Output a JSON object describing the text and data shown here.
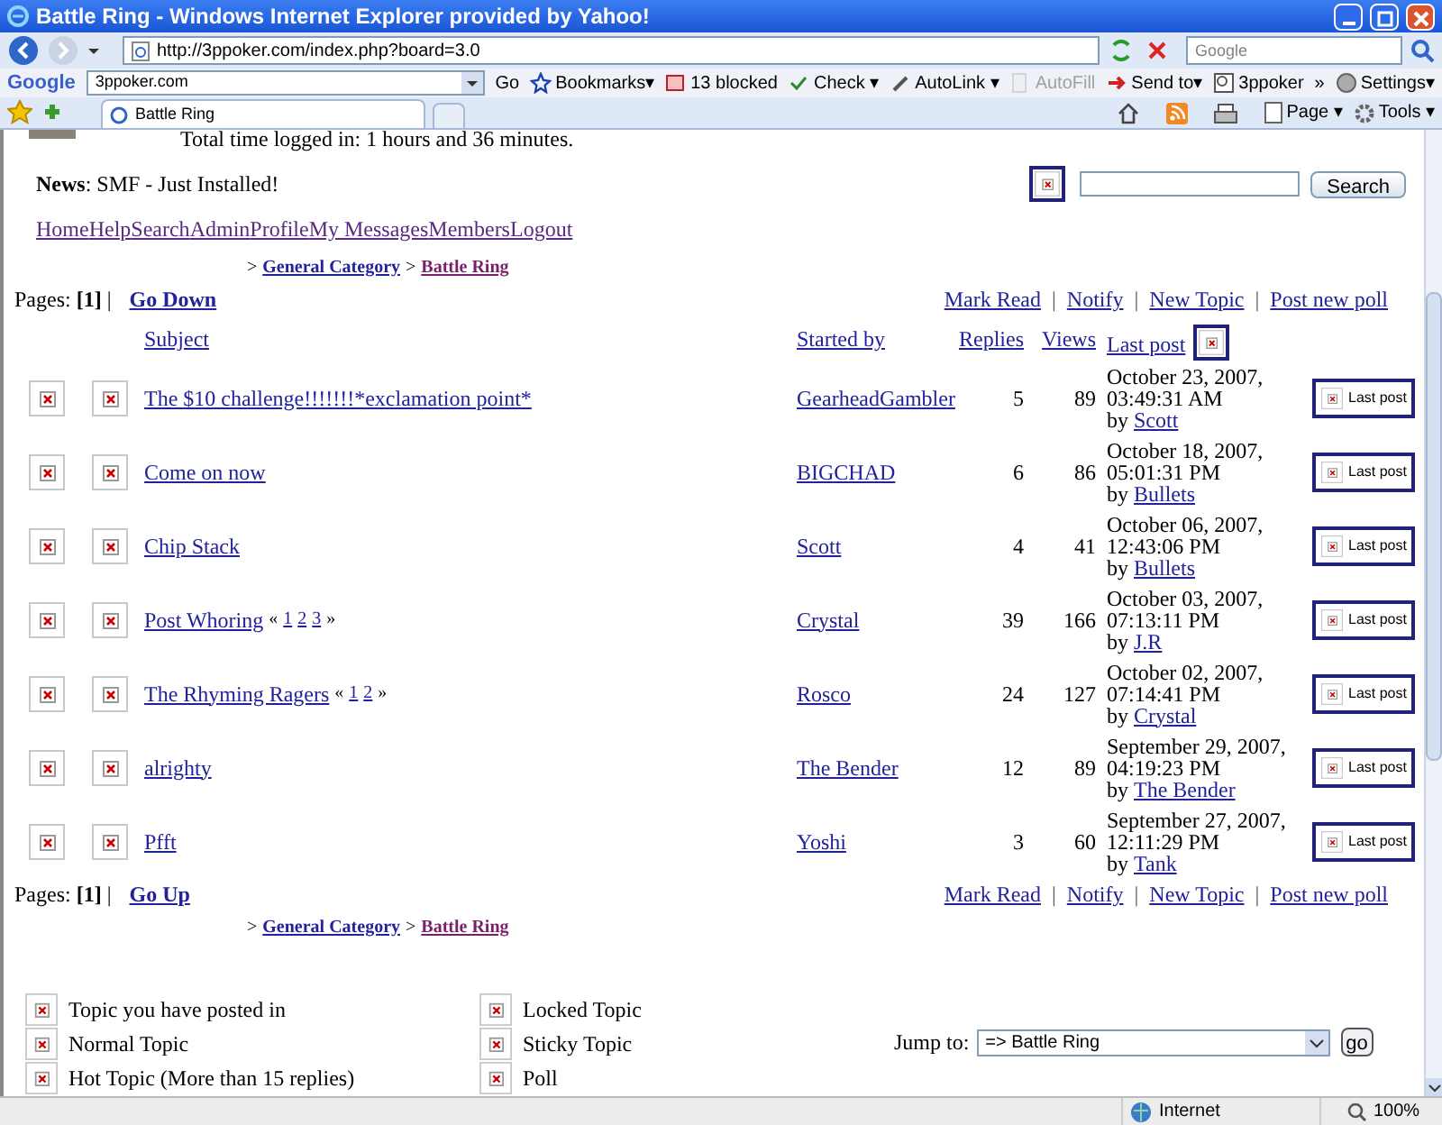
{
  "window": {
    "title": "Battle Ring - Windows Internet Explorer provided by Yahoo!"
  },
  "address_bar": {
    "url": "http://3ppoker.com/index.php?board=3.0",
    "search_placeholder": "Google"
  },
  "google_toolbar": {
    "label": "Google",
    "search_value": "3ppoker.com",
    "items": [
      {
        "label": "Go",
        "disabled": false
      },
      {
        "label": "Bookmarks▾",
        "disabled": false
      },
      {
        "label": "13 blocked",
        "disabled": false
      },
      {
        "label": "Check ▾",
        "disabled": false
      },
      {
        "label": "AutoLink ▾",
        "disabled": false
      },
      {
        "label": "AutoFill",
        "disabled": true
      },
      {
        "label": "Send to▾",
        "disabled": false
      },
      {
        "label": "3ppoker",
        "disabled": false
      },
      {
        "label": "»",
        "disabled": false
      }
    ],
    "settings": "Settings▾"
  },
  "tabs": [
    {
      "label": "Battle Ring",
      "selected": true
    }
  ],
  "command_bar": {
    "page": "Page ▾",
    "tools": "Tools ▾"
  },
  "page": {
    "login_time": "Total time logged in: 1 hours and 36 minutes.",
    "news": "**News**: SMF - Just Installed!",
    "search_button": "Search",
    "nav_links": [
      "Home",
      "Help",
      "Search",
      "Admin",
      "Profile",
      "My Messages",
      "Members",
      "Logout"
    ],
    "breadcrumb_separator": ">",
    "breadcrumb": [
      "General Category",
      "Battle Ring"
    ],
    "pages_top": "Pages: **[1]** |",
    "go_down": "Go Down",
    "actions_top": [
      "Mark Read",
      "Notify",
      "New Topic",
      "Post new poll"
    ],
    "action_separator": "|",
    "columns": [
      "Subject",
      "Started by",
      "Replies",
      "Views",
      "Last post"
    ],
    "page_nav_open": "«",
    "page_nav_close": "»",
    "rows": [
      {
        "subject": "The $10 challenge!!!!!!!*exclamation point*",
        "pages": [],
        "started_by": "GearheadGambler",
        "replies": "5",
        "views": "89",
        "last_post": "October 23, 2007, 03:49:31 AM",
        "by": "by",
        "last_by": "Scott",
        "button": "Last post"
      },
      {
        "subject": "Come on now",
        "pages": [],
        "started_by": "BIGCHAD",
        "replies": "6",
        "views": "86",
        "last_post": "October 18, 2007, 05:01:31 PM",
        "by": "by",
        "last_by": "Bullets",
        "button": "Last post"
      },
      {
        "subject": "Chip Stack",
        "pages": [],
        "started_by": "Scott",
        "replies": "4",
        "views": "41",
        "last_post": "October 06, 2007, 12:43:06 PM",
        "by": "by",
        "last_by": "Bullets",
        "button": "Last post"
      },
      {
        "subject": "Post Whoring",
        "pages": [
          "1",
          "2",
          "3"
        ],
        "started_by": "Crystal",
        "replies": "39",
        "views": "166",
        "last_post": "October 03, 2007, 07:13:11 PM",
        "by": "by",
        "last_by": "J.R",
        "button": "Last post"
      },
      {
        "subject": "The Rhyming Ragers",
        "pages": [
          "1",
          "2"
        ],
        "started_by": "Rosco",
        "replies": "24",
        "views": "127",
        "last_post": "October 02, 2007, 07:14:41 PM",
        "by": "by",
        "last_by": "Crystal",
        "button": "Last post"
      },
      {
        "subject": "alrighty",
        "pages": [],
        "started_by": "The Bender",
        "replies": "12",
        "views": "89",
        "last_post": "September 29, 2007, 04:19:23 PM",
        "by": "by",
        "last_by": "The Bender",
        "button": "Last post"
      },
      {
        "subject": "Pfft",
        "pages": [],
        "started_by": "Yoshi",
        "replies": "3",
        "views": "60",
        "last_post": "September 27, 2007, 12:11:29 PM",
        "by": "by",
        "last_by": "Tank",
        "button": "Last post"
      }
    ],
    "pages_bottom": "Pages: **[1]** |",
    "go_up": "Go Up",
    "actions_bottom": [
      "Mark Read",
      "Notify",
      "New Topic",
      "Post new poll"
    ],
    "breadcrumb_bottom": [
      "General Category",
      "Battle Ring"
    ],
    "legend": [
      "Topic you have posted in",
      "Normal Topic",
      "Hot Topic (More than 15 replies)",
      "Locked Topic",
      "Sticky Topic",
      "Poll"
    ],
    "jump_to_label": "Jump to:",
    "jump_to_value": "=> Battle Ring",
    "go_button": "go"
  },
  "status_bar": {
    "zone": "Internet",
    "zoom": "100%"
  }
}
